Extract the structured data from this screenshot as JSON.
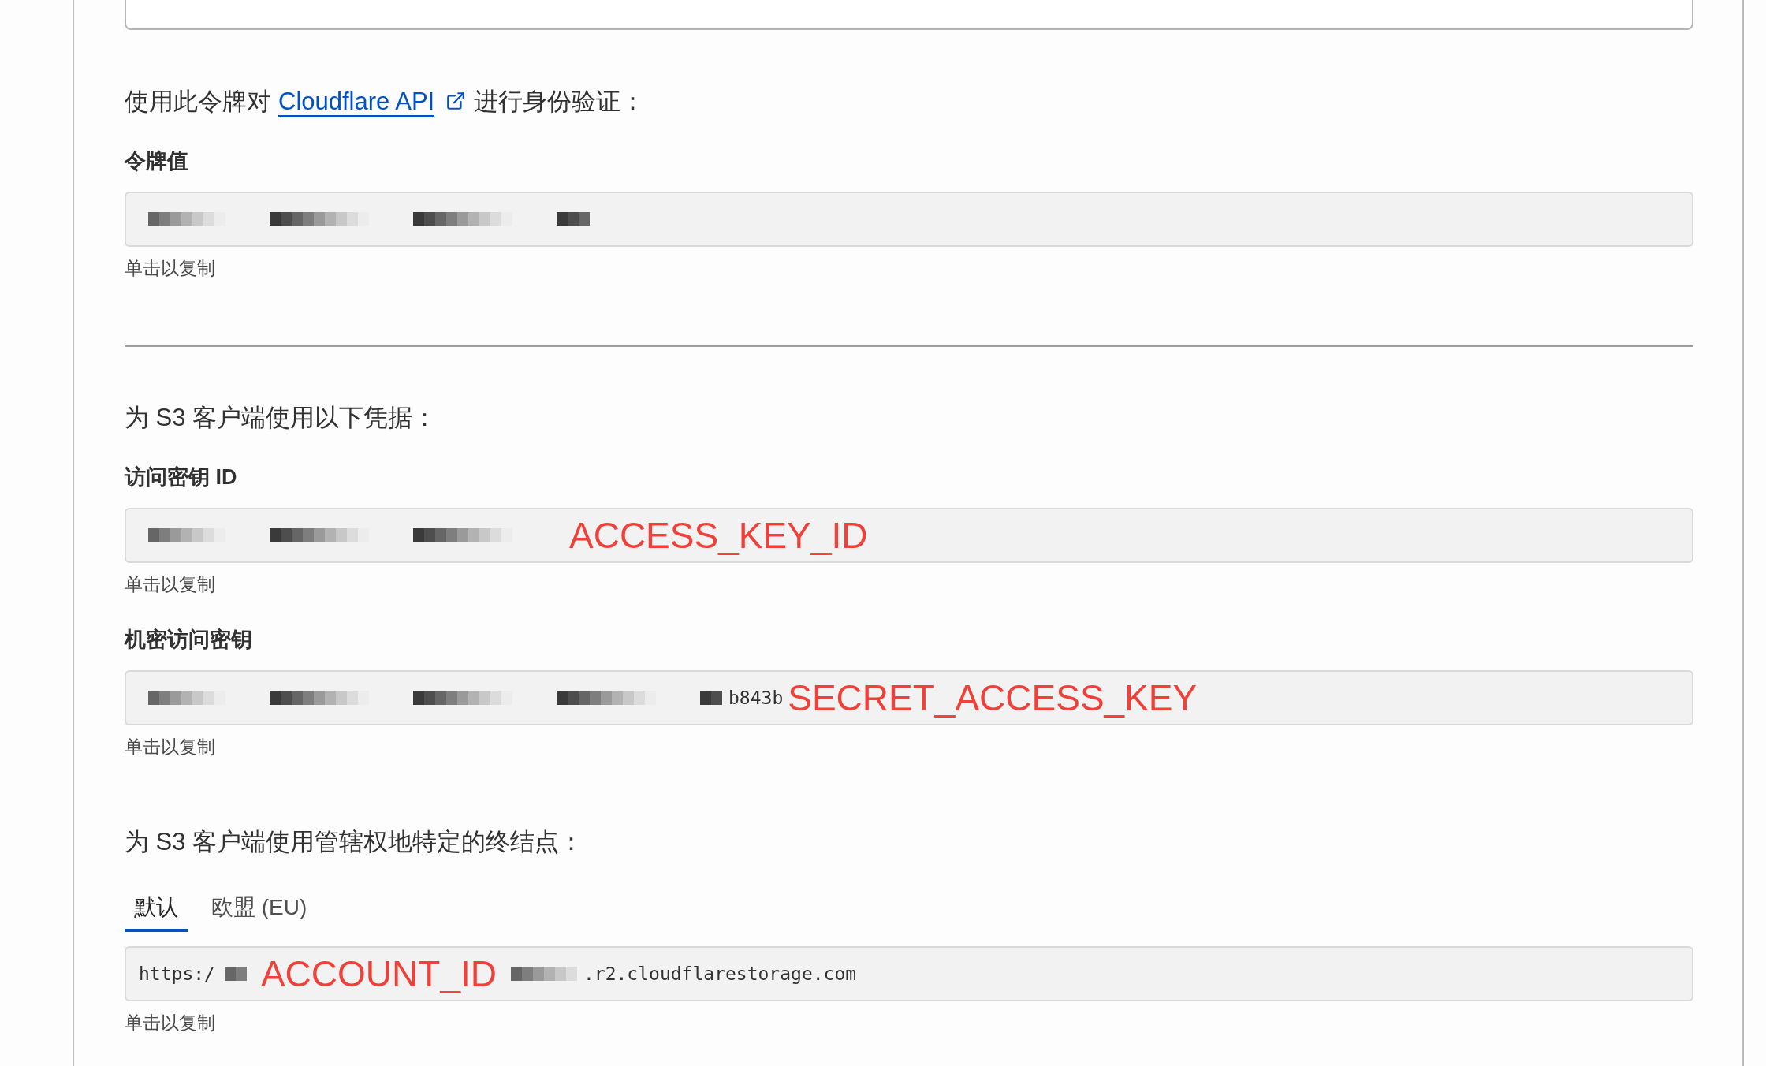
{
  "token_section": {
    "intro": {
      "before": "使用此令牌对",
      "link": "Cloudflare API",
      "after": "进行身份验证："
    },
    "field": {
      "label": "令牌值",
      "parts": [
        {
          "kind": "redacted"
        }
      ],
      "hint": "单击以复制"
    }
  },
  "s3_section": {
    "intro": "为 S3 客户端使用以下凭据：",
    "fields": [
      {
        "label": "访问密钥 ID",
        "parts": [
          {
            "kind": "redacted"
          },
          {
            "kind": "annotation",
            "text": "ACCESS_KEY_ID"
          }
        ],
        "hint": "单击以复制"
      },
      {
        "label": "机密访问密钥",
        "parts": [
          {
            "kind": "redacted"
          },
          {
            "kind": "text",
            "text": "b843b"
          },
          {
            "kind": "annotation",
            "text": "SECRET_ACCESS_KEY"
          }
        ],
        "hint": "单击以复制"
      }
    ]
  },
  "endpoint_section": {
    "intro": "为 S3 客户端使用管辖权地特定的终结点：",
    "tabs": [
      {
        "label": "默认",
        "selected": true
      },
      {
        "label": "欧盟 (EU)",
        "selected": false
      }
    ],
    "field": {
      "parts": [
        {
          "kind": "text",
          "text": "https:/"
        },
        {
          "kind": "redacted"
        },
        {
          "kind": "annotation",
          "text": "ACCOUNT_ID"
        },
        {
          "kind": "redacted"
        },
        {
          "kind": "text",
          "text": ".r2.cloudflarestorage.com"
        }
      ],
      "hint": "单击以复制"
    }
  }
}
